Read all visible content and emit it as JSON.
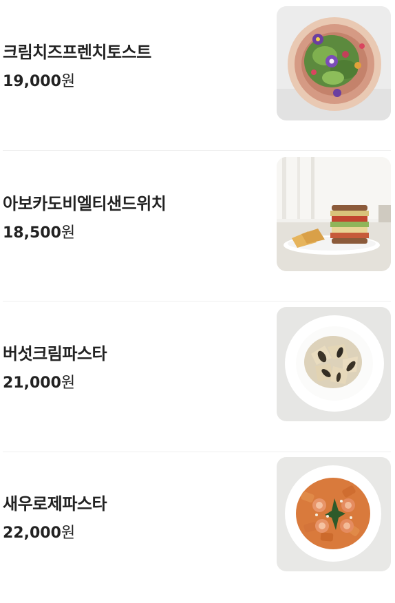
{
  "menu": {
    "items": [
      {
        "name": "크림치즈프렌치토스트",
        "price": "19,000",
        "currency": "원",
        "image": "salad-bowl-with-edible-flowers-photo"
      },
      {
        "name": "아보카도비엘티샌드위치",
        "price": "18,500",
        "currency": "원",
        "image": "blt-sandwich-with-chips-photo"
      },
      {
        "name": "버섯크림파스타",
        "price": "21,000",
        "currency": "원",
        "image": "mushroom-cream-pasta-photo"
      },
      {
        "name": "새우로제파스타",
        "price": "22,000",
        "currency": "원",
        "image": "shrimp-rose-pasta-photo"
      }
    ]
  }
}
